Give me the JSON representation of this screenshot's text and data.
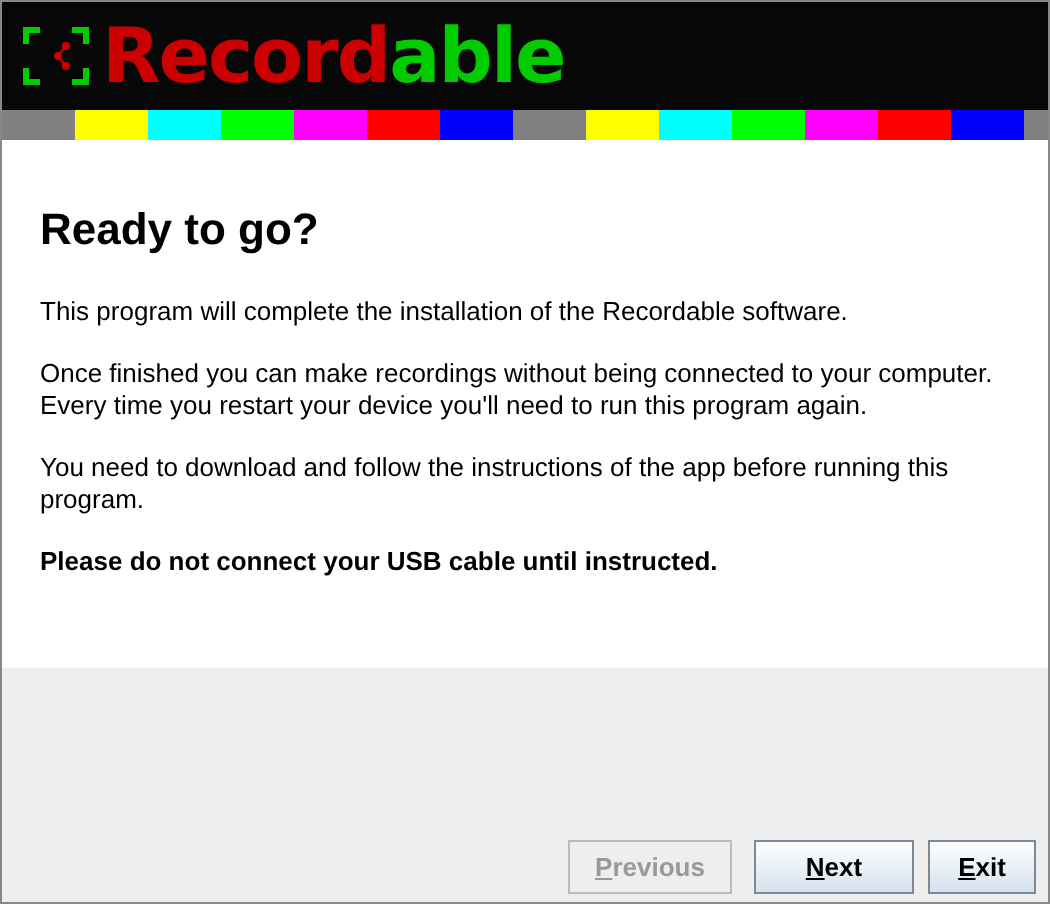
{
  "logo": {
    "parts": [
      {
        "text": "Record",
        "color": "#cc0000"
      },
      {
        "text": "able",
        "color": "#00cc00"
      }
    ]
  },
  "heading": "Ready to go?",
  "paragraphs": [
    {
      "text": "This program will complete the installation of the Recordable software.",
      "bold": false
    },
    {
      "text": "Once finished you can make recordings without being connected to your computer. Every time you restart your device you'll need to run this program again.",
      "bold": false
    },
    {
      "text": "You need to download and follow the instructions of the app before running this program.",
      "bold": false
    },
    {
      "text": "Please do not connect your USB cable until instructed.",
      "bold": true
    }
  ],
  "buttons": [
    {
      "label": "Previous",
      "disabled": true,
      "underline_first": true
    },
    {
      "label": "Next",
      "disabled": false,
      "underline_first": true
    },
    {
      "label": "Exit",
      "disabled": false,
      "underline_first": true
    }
  ]
}
